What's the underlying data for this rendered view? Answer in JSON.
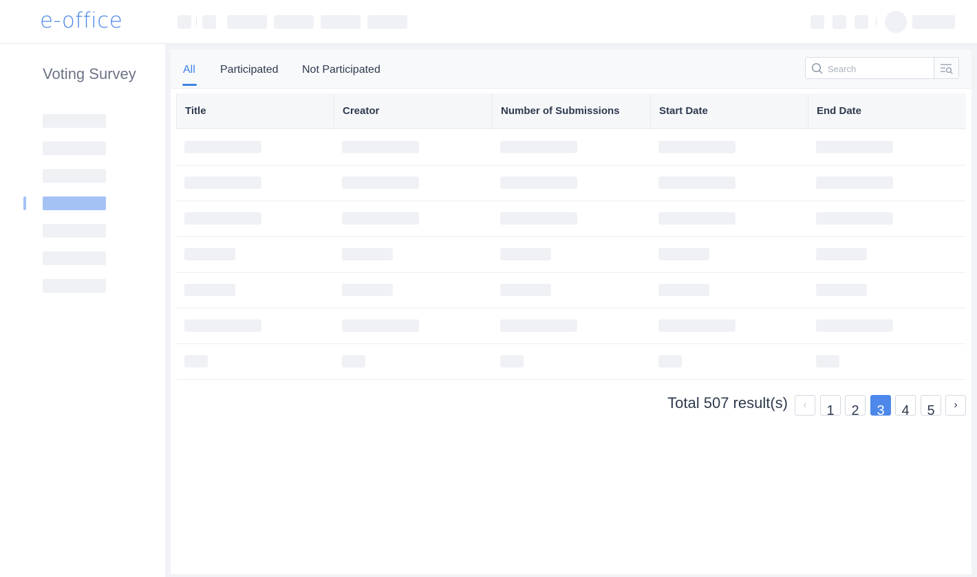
{
  "app": {
    "logo": "e-office"
  },
  "sidebar": {
    "title": "Voting Survey"
  },
  "tabs": [
    {
      "label": "All",
      "active": true
    },
    {
      "label": "Participated",
      "active": false
    },
    {
      "label": "Not Participated",
      "active": false
    }
  ],
  "search": {
    "placeholder": "Search",
    "value": ""
  },
  "table": {
    "columns": [
      "Title",
      "Creator",
      "Number of Submissions",
      "Start Date",
      "End Date"
    ],
    "row_count": 7
  },
  "pagination": {
    "total_text": "Total 507 result(s)",
    "pages": [
      "1",
      "2",
      "3",
      "4",
      "5"
    ],
    "current_page": "3",
    "prev_icon": "chevron-left-icon",
    "next_icon": "chevron-right-icon"
  },
  "colors": {
    "accent": "#3b82e6",
    "logo": "#4d88ea",
    "active_page": "#4d88ea",
    "placeholder_block": "#eff1f5",
    "sidebar_active": "#a5c2f5"
  }
}
